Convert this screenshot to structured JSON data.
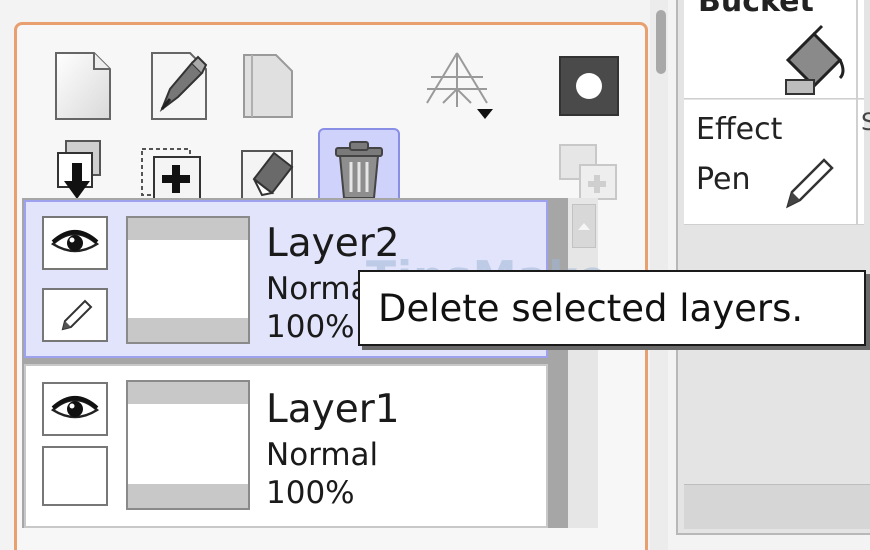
{
  "layer_panel": {
    "toolbar": {
      "row1": [
        {
          "icon": "new-layer-icon"
        },
        {
          "icon": "new-pen-layer-icon"
        },
        {
          "icon": "new-layer-folder-icon"
        },
        {
          "icon": "perspective-ruler-icon"
        },
        {
          "icon": "layer-mask-icon"
        }
      ],
      "row2": [
        {
          "icon": "transfer-down-icon"
        },
        {
          "icon": "merge-down-icon"
        },
        {
          "icon": "clear-layer-icon"
        },
        {
          "icon": "trash-icon",
          "active": true
        },
        {
          "icon": "link-layers-icon",
          "disabled": true
        }
      ]
    },
    "layers": [
      {
        "name": "Layer2",
        "mode": "Normal",
        "opacity": "100%",
        "selected": true,
        "pen_locked": true
      },
      {
        "name": "Layer1",
        "mode": "Normal",
        "opacity": "100%",
        "selected": false,
        "pen_locked": false
      }
    ]
  },
  "tool_panel": {
    "top_label": "Bucket",
    "effect_label": "Effect",
    "pen_label": "Pen",
    "side_letter": "S"
  },
  "tooltip": {
    "text": "Delete selected layers."
  },
  "watermark": {
    "text": "TipsMake"
  },
  "colors": {
    "panel_border": "#e8a070",
    "selected_layer_bg": "#e2e4fb",
    "active_button_bg": "#cfd2fb"
  }
}
